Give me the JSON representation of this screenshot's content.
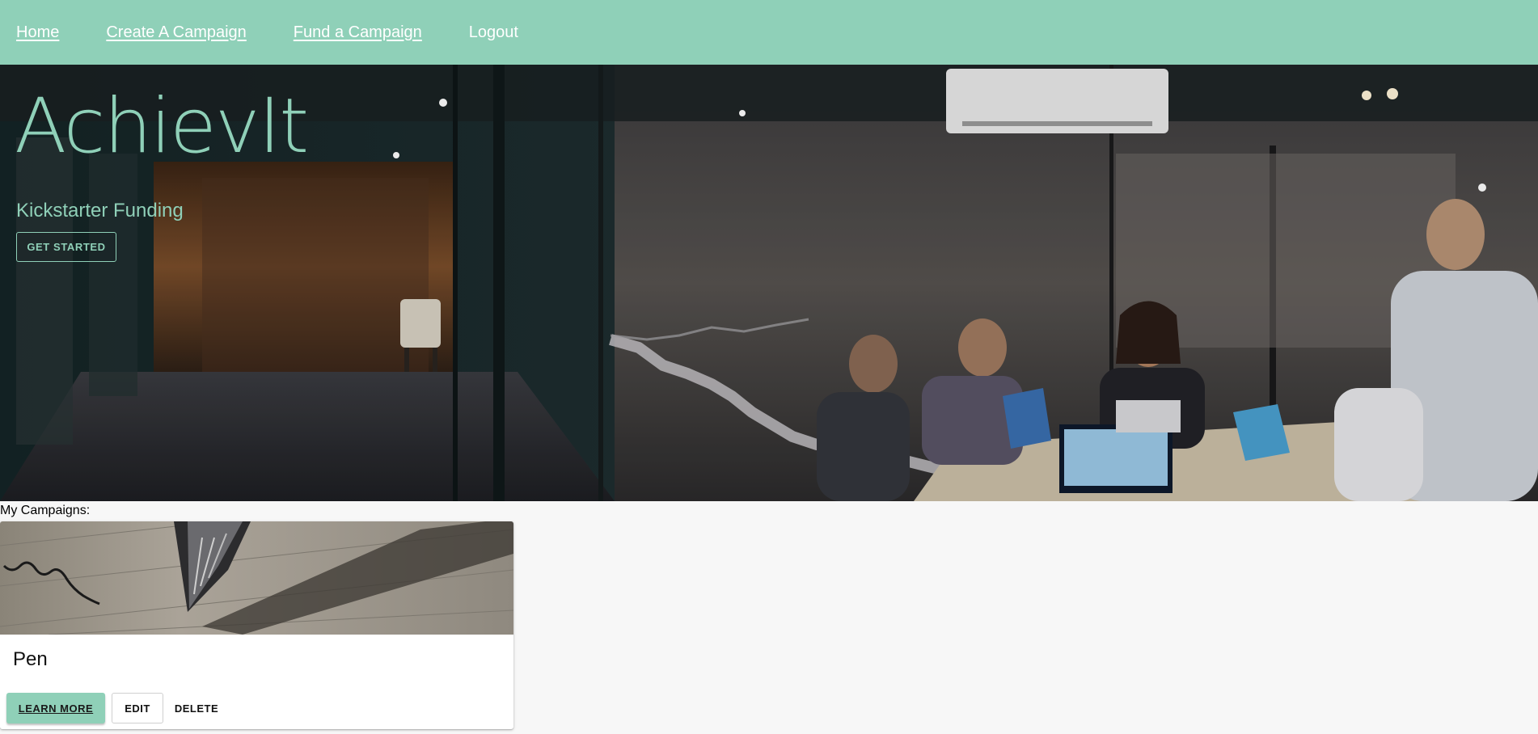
{
  "nav": {
    "home": "Home",
    "create": "Create A Campaign",
    "fund": "Fund a Campaign",
    "logout": "Logout"
  },
  "hero": {
    "brand": "AchievIt",
    "tagline": "Kickstarter Funding",
    "cta": "GET STARTED",
    "image": "office-meeting-photo"
  },
  "campaigns": {
    "label": "My Campaigns:",
    "items": [
      {
        "title": "Pen",
        "image": "fountain-pen-writing-photo",
        "learn_more": "LEARN MORE",
        "edit": "EDIT",
        "delete": "DELETE"
      }
    ]
  },
  "colors": {
    "accent": "#8fd0b8",
    "background": "#f7f7f7"
  }
}
